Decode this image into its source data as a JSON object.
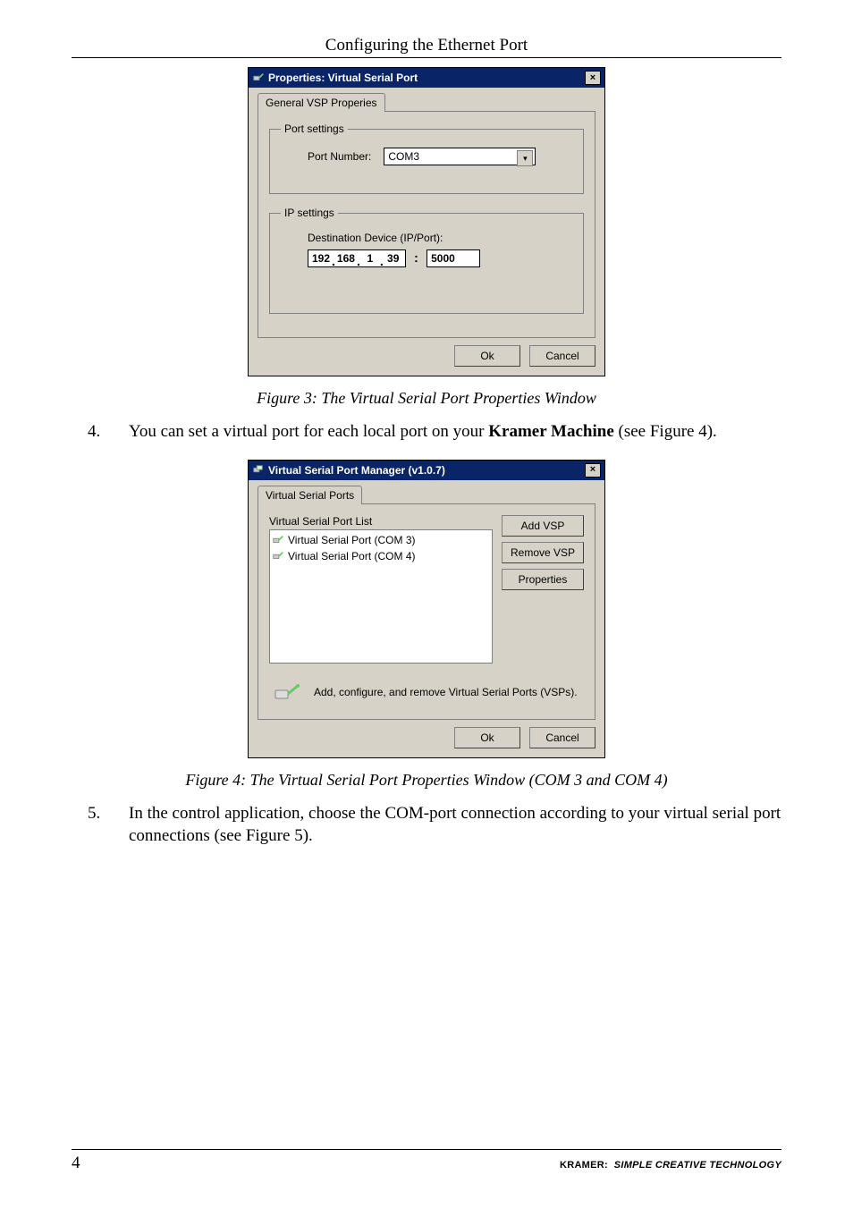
{
  "page_header": "Configuring the Ethernet Port",
  "dlg1": {
    "title": "Properties: Virtual Serial Port",
    "tab": "General VSP Properies",
    "group_port": "Port settings",
    "port_number_label": "Port Number:",
    "port_number_value": "COM3",
    "group_ip": "IP settings",
    "dest_label": "Destination Device (IP/Port):",
    "ip": {
      "o1": "192",
      "o2": "168",
      "o3": "1",
      "o4": "39"
    },
    "port_value": "5000",
    "ok": "Ok",
    "cancel": "Cancel"
  },
  "caption1": "Figure 3: The Virtual Serial Port Properties Window",
  "para4": {
    "num": "4.",
    "text_a": "You can set a virtual port for each local port on your ",
    "text_bold": "Kramer Machine",
    "text_b": " (see Figure 4)."
  },
  "dlg2": {
    "title": "Virtual Serial Port Manager (v1.0.7)",
    "tab": "Virtual Serial Ports",
    "list_title": "Virtual Serial Port List",
    "items": [
      "Virtual Serial Port (COM 3)",
      "Virtual Serial Port (COM 4)"
    ],
    "btn_add": "Add VSP",
    "btn_remove": "Remove VSP",
    "btn_props": "Properties",
    "info_text": "Add, configure, and remove Virtual Serial Ports (VSPs).",
    "ok": "Ok",
    "cancel": "Cancel"
  },
  "caption2": "Figure 4: The Virtual Serial Port Properties Window (COM 3 and COM 4)",
  "para5": {
    "num": "5.",
    "text": "In the control application, choose the COM-port connection according to your virtual serial port connections (see Figure 5)."
  },
  "footer": {
    "page": "4",
    "brand": "KRAMER:",
    "tagline": "SIMPLE CREATIVE TECHNOLOGY"
  }
}
